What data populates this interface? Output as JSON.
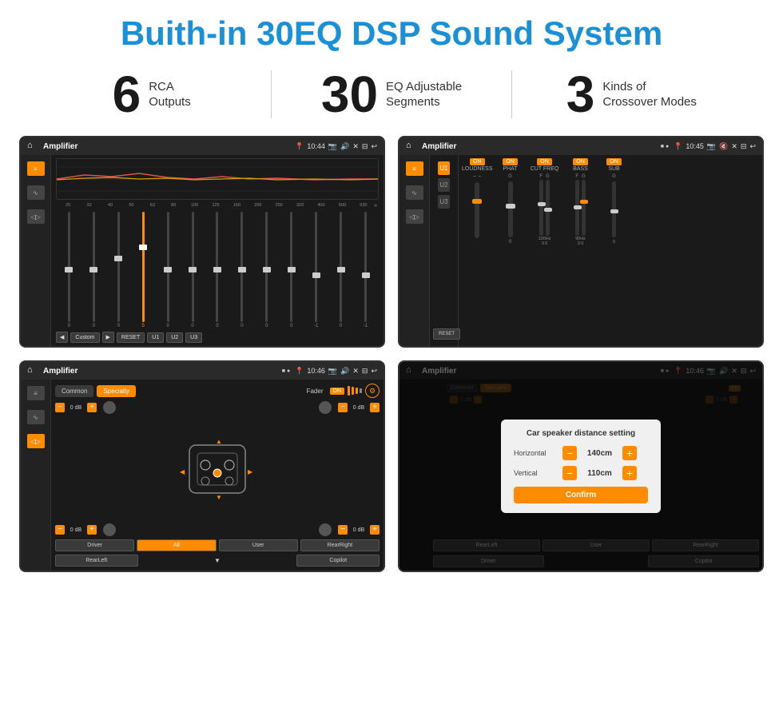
{
  "header": {
    "title": "Buith-in 30EQ DSP Sound System"
  },
  "stats": [
    {
      "number": "6",
      "label": "RCA\nOutputs"
    },
    {
      "number": "30",
      "label": "EQ Adjustable\nSegments"
    },
    {
      "number": "3",
      "label": "Kinds of\nCrossover Modes"
    }
  ],
  "screens": [
    {
      "id": "screen1",
      "statusBar": {
        "title": "Amplifier",
        "time": "10:44"
      },
      "type": "eq"
    },
    {
      "id": "screen2",
      "statusBar": {
        "title": "Amplifier",
        "time": "10:45"
      },
      "type": "amp"
    },
    {
      "id": "screen3",
      "statusBar": {
        "title": "Amplifier",
        "time": "10:46"
      },
      "type": "fader"
    },
    {
      "id": "screen4",
      "statusBar": {
        "title": "Amplifier",
        "time": "10:46"
      },
      "type": "distance"
    }
  ],
  "eq": {
    "freqLabels": [
      "25",
      "32",
      "40",
      "50",
      "63",
      "80",
      "100",
      "125",
      "160",
      "200",
      "250",
      "320",
      "400",
      "500",
      "630"
    ],
    "values": [
      "0",
      "0",
      "0",
      "5",
      "0",
      "0",
      "0",
      "0",
      "0",
      "0",
      "-1",
      "0",
      "-1"
    ],
    "presets": [
      "Custom",
      "RESET",
      "U1",
      "U2",
      "U3"
    ]
  },
  "amp": {
    "uButtons": [
      "U1",
      "U2",
      "U3"
    ],
    "controls": [
      "LOUDNESS",
      "PHAT",
      "CUT FREQ",
      "BASS",
      "SUB"
    ],
    "onLabels": [
      "ON",
      "ON",
      "ON",
      "ON",
      "ON"
    ],
    "resetLabel": "RESET"
  },
  "fader": {
    "tabs": [
      "Common",
      "Specialty"
    ],
    "faderLabel": "Fader",
    "onLabel": "ON",
    "dbValues": [
      "0 dB",
      "0 dB",
      "0 dB",
      "0 dB"
    ],
    "buttons": [
      "Driver",
      "All",
      "User",
      "RearRight",
      "RearLeft",
      "Copilot"
    ]
  },
  "distance": {
    "dialogTitle": "Car speaker distance setting",
    "horizontal": {
      "label": "Horizontal",
      "value": "140cm"
    },
    "vertical": {
      "label": "Vertical",
      "value": "110cm"
    },
    "confirmLabel": "Confirm",
    "fader": {
      "tabs": [
        "Common",
        "Specialty"
      ],
      "onLabel": "ON"
    },
    "dbValues": [
      "0 dB",
      "0 dB"
    ],
    "buttons": [
      "Driver",
      "Copilot",
      "RearLeft",
      "User",
      "RearRight"
    ]
  }
}
